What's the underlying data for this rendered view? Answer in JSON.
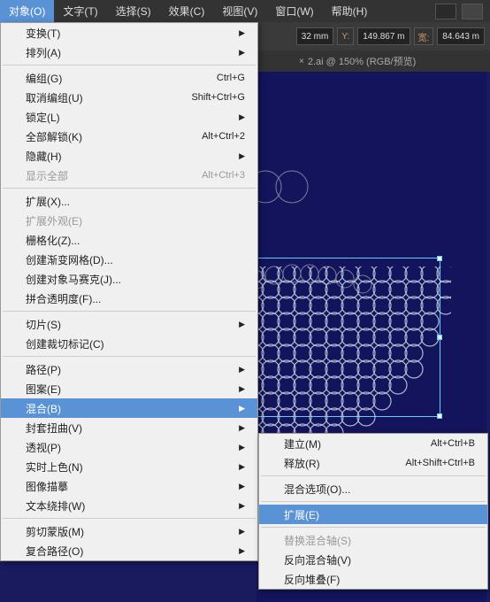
{
  "menubar": {
    "items": [
      "对象(O)",
      "文字(T)",
      "选择(S)",
      "效果(C)",
      "视图(V)",
      "窗口(W)",
      "帮助(H)"
    ]
  },
  "toolbar": {
    "x_val": "32 mm",
    "y_lab": "Y:",
    "y_val": "149.867 m",
    "w_lab": "宽:",
    "w_val": "84.643 m"
  },
  "tab": {
    "label": "2.ai @ 150% (RGB/预览)"
  },
  "menu1": {
    "transform": "变换(T)",
    "arrange": "排列(A)",
    "group": "编组(G)",
    "group_sc": "Ctrl+G",
    "ungroup": "取消编组(U)",
    "ungroup_sc": "Shift+Ctrl+G",
    "lock": "锁定(L)",
    "unlock_all": "全部解锁(K)",
    "unlock_all_sc": "Alt+Ctrl+2",
    "hide": "隐藏(H)",
    "show_all": "显示全部",
    "show_all_sc": "Alt+Ctrl+3",
    "expand": "扩展(X)...",
    "expand_app": "扩展外观(E)",
    "rasterize": "栅格化(Z)...",
    "gradient_mesh": "创建渐变网格(D)...",
    "mosaic": "创建对象马赛克(J)...",
    "flatten": "拼合透明度(F)...",
    "slice": "切片(S)",
    "crop_marks": "创建裁切标记(C)",
    "path": "路径(P)",
    "pattern": "图案(E)",
    "blend": "混合(B)",
    "envelope": "封套扭曲(V)",
    "perspective": "透视(P)",
    "live_paint": "实时上色(N)",
    "image_trace": "图像描摹",
    "text_wrap": "文本绕排(W)",
    "clipping_mask": "剪切蒙版(M)",
    "compound_path": "复合路径(O)"
  },
  "menu2": {
    "make": "建立(M)",
    "make_sc": "Alt+Ctrl+B",
    "release": "释放(R)",
    "release_sc": "Alt+Shift+Ctrl+B",
    "options": "混合选项(O)...",
    "expand": "扩展(E)",
    "replace_spine": "替换混合轴(S)",
    "reverse_spine": "反向混合轴(V)",
    "reverse_stack": "反向堆叠(F)"
  }
}
